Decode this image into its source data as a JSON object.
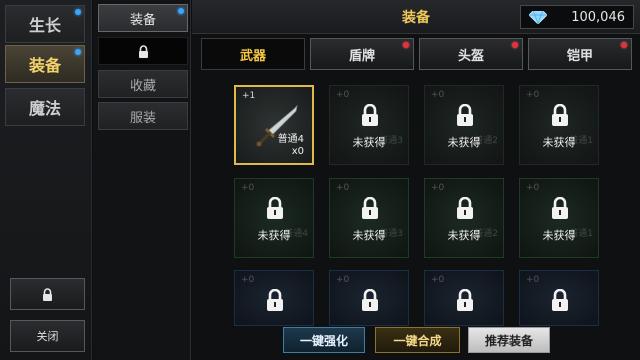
{
  "sidebar": {
    "tabs": [
      {
        "label": "生长",
        "badge": "blue"
      },
      {
        "label": "装备",
        "badge": "blue",
        "active": true
      },
      {
        "label": "魔法"
      }
    ],
    "close_label": "关闭"
  },
  "subnav": {
    "items": [
      {
        "label": "装备",
        "badge": "blue"
      },
      {
        "label": ""
      },
      {
        "label": "收藏"
      },
      {
        "label": "服装"
      }
    ]
  },
  "header": {
    "title": "装备",
    "gems": "100,046"
  },
  "tabs": [
    {
      "label": "武器",
      "active": true
    },
    {
      "label": "盾牌",
      "badge": "red"
    },
    {
      "label": "头盔",
      "badge": "red"
    },
    {
      "label": "铠甲",
      "badge": "red"
    }
  ],
  "grid": {
    "selected": {
      "level": "+1",
      "name": "普通4",
      "count": "x0"
    },
    "locked_label": "未获得",
    "plus_zero": "+0",
    "row1_ghost": [
      "普通3",
      "普通2",
      "普通1"
    ],
    "row2_ghost": [
      "普通4",
      "普通3",
      "普通2",
      "普通1"
    ]
  },
  "actions": {
    "enhance": "一键强化",
    "combine": "一键合成",
    "recommend": "推荐装备"
  },
  "colors": {
    "accent": "#f0c95a",
    "badge_blue": "#35a7ff",
    "badge_red": "#e8303a"
  }
}
